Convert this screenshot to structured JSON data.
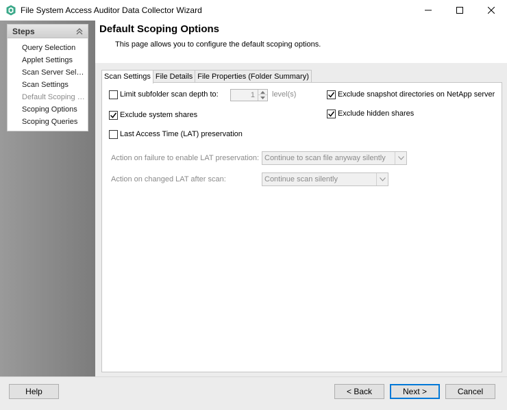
{
  "window": {
    "title": "File System Access Auditor Data Collector Wizard",
    "accent_color": "#0078d7",
    "icon": "app-hexagon-icon"
  },
  "sidebar": {
    "header": "Steps",
    "items": [
      {
        "label": "Query Selection",
        "current": false
      },
      {
        "label": "Applet Settings",
        "current": false
      },
      {
        "label": "Scan Server Selection",
        "current": false
      },
      {
        "label": "Scan Settings",
        "current": false
      },
      {
        "label": "Default Scoping Options",
        "current": true
      },
      {
        "label": "Scoping Options",
        "current": false
      },
      {
        "label": "Scoping Queries",
        "current": false
      }
    ]
  },
  "page": {
    "title": "Default Scoping Options",
    "description": "This page allows you to configure the default scoping options."
  },
  "tabs": [
    {
      "label": "Scan Settings",
      "active": true
    },
    {
      "label": "File Details",
      "active": false
    },
    {
      "label": "File Properties (Folder Summary)",
      "active": false
    }
  ],
  "options": {
    "limit_depth": {
      "label": "Limit subfolder scan depth to:",
      "checked": false,
      "value": "1",
      "unit": "level(s)"
    },
    "exclude_system_shares": {
      "label": "Exclude system shares",
      "checked": true
    },
    "lat_preservation": {
      "label": "Last Access Time (LAT) preservation",
      "checked": false
    },
    "exclude_snapshot": {
      "label": "Exclude snapshot directories on NetApp server",
      "checked": true
    },
    "exclude_hidden": {
      "label": "Exclude hidden shares",
      "checked": true
    },
    "lat_failure_action": {
      "label": "Action on failure to enable LAT preservation:",
      "value": "Continue to scan file anyway silently"
    },
    "lat_changed_action": {
      "label": "Action on changed LAT after scan:",
      "value": "Continue scan silently"
    }
  },
  "footer": {
    "help": "Help",
    "back": "< Back",
    "next": "Next >",
    "cancel": "Cancel"
  }
}
